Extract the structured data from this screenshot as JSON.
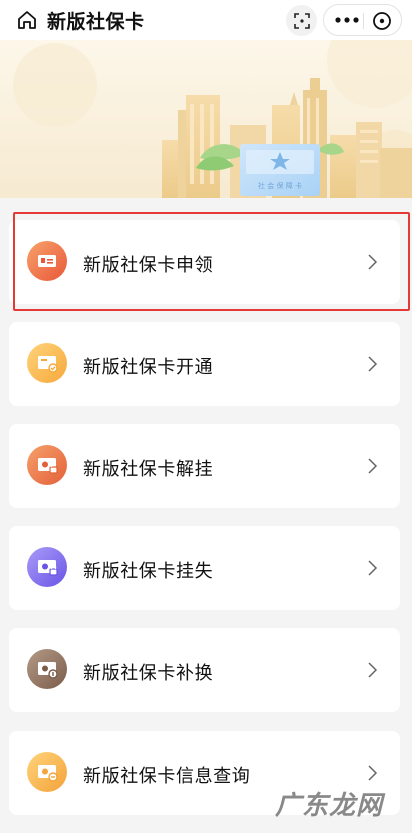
{
  "header": {
    "title": "新版社保卡"
  },
  "banner": {
    "card_text": "社 会 保 障 卡"
  },
  "menu": [
    {
      "label": "新版社保卡申领",
      "icon": "id-card-icon",
      "colors": [
        "#f7a26a",
        "#e9573a"
      ]
    },
    {
      "label": "新版社保卡开通",
      "icon": "card-check-icon",
      "colors": [
        "#ffd37a",
        "#f6a93b"
      ]
    },
    {
      "label": "新版社保卡解挂",
      "icon": "card-unlock-icon",
      "colors": [
        "#f5a06a",
        "#e4603a"
      ]
    },
    {
      "label": "新版社保卡挂失",
      "icon": "card-lock-icon",
      "colors": [
        "#a89cf7",
        "#6a54e6"
      ]
    },
    {
      "label": "新版社保卡补换",
      "icon": "card-replace-icon",
      "colors": [
        "#b49a88",
        "#7b5c4a"
      ]
    },
    {
      "label": "新版社保卡信息查询",
      "icon": "card-query-icon",
      "colors": [
        "#ffd37a",
        "#f3a33a"
      ]
    }
  ],
  "watermark": "广东龙网",
  "colors": {
    "highlight": "#e53935",
    "background": "#f4f4f4"
  }
}
